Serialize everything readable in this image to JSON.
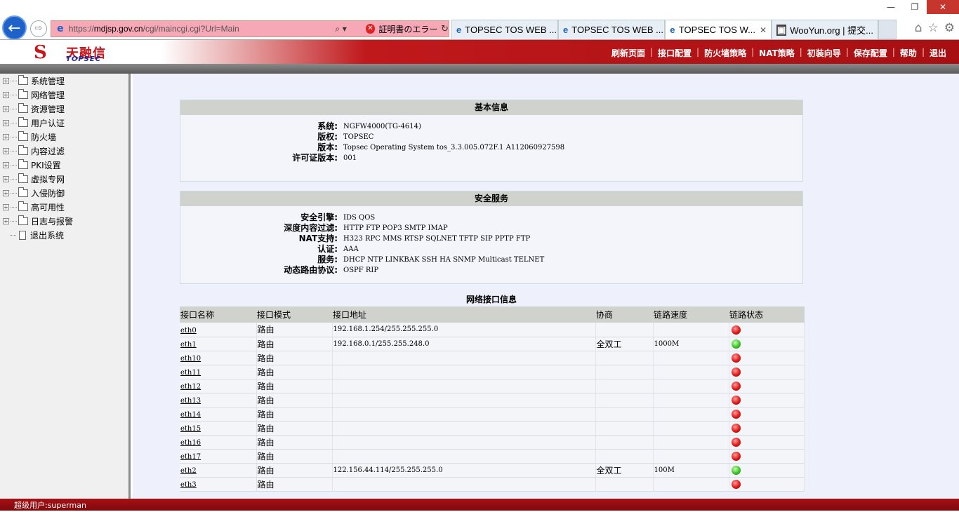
{
  "browser": {
    "address_url_prefix": "https://",
    "address_url_host": "mdjsp.gov.cn",
    "address_url_path": "/cgi/maincgi.cgi?Url=Main",
    "cert_error": "証明書のエラー",
    "tabs": [
      {
        "label": "TOPSEC TOS WEB ...",
        "active": false
      },
      {
        "label": "TOPSEC TOS WEB ...",
        "active": false
      },
      {
        "label": "TOPSEC TOS W...",
        "active": true
      },
      {
        "label": "WooYun.org | 提交...",
        "active": false
      }
    ]
  },
  "header": {
    "logo_cn": "天融信",
    "logo_en": "TOPSEC",
    "menu": [
      "刷新页面",
      "接口配置",
      "防火墙策略",
      "NAT策略",
      "初装向导",
      "保存配置",
      "帮助",
      "退出"
    ]
  },
  "sidebar": {
    "items": [
      "系统管理",
      "网络管理",
      "资源管理",
      "用户认证",
      "防火墙",
      "内容过滤",
      "PKI设置",
      "虚拟专网",
      "入侵防御",
      "高可用性",
      "日志与报警",
      "退出系统"
    ]
  },
  "basic_info": {
    "title": "基本信息",
    "rows": [
      {
        "k": "系统:",
        "v": "NGFW4000(TG-4614)"
      },
      {
        "k": "版权:",
        "v": "TOPSEC"
      },
      {
        "k": "版本:",
        "v": "Topsec Operating System tos_3.3.005.072F.1 A112060927598"
      },
      {
        "k": "许可证版本:",
        "v": "001"
      }
    ]
  },
  "security_services": {
    "title": "安全服务",
    "rows": [
      {
        "k": "安全引擎:",
        "v": "IDS QOS"
      },
      {
        "k": "深度内容过滤:",
        "v": "HTTP FTP POP3 SMTP IMAP"
      },
      {
        "k": "NAT支持:",
        "v": "H323 RPC MMS RTSP SQLNET TFTP SIP PPTP FTP"
      },
      {
        "k": "认证:",
        "v": "AAA"
      },
      {
        "k": "服务:",
        "v": "DHCP NTP LINKBAK SSH HA SNMP Multicast TELNET"
      },
      {
        "k": "动态路由协议:",
        "v": "OSPF RIP"
      }
    ]
  },
  "interfaces": {
    "title": "网络接口信息",
    "columns": [
      "接口名称",
      "接口模式",
      "接口地址",
      "协商",
      "链路速度",
      "链路状态"
    ],
    "rows": [
      {
        "name": "eth0",
        "mode": "路由",
        "addr": "192.168.1.254/255.255.255.0",
        "neg": "",
        "speed": "",
        "status": "down"
      },
      {
        "name": "eth1",
        "mode": "路由",
        "addr": "192.168.0.1/255.255.248.0",
        "neg": "全双工",
        "speed": "1000M",
        "status": "up"
      },
      {
        "name": "eth10",
        "mode": "路由",
        "addr": "",
        "neg": "",
        "speed": "",
        "status": "down"
      },
      {
        "name": "eth11",
        "mode": "路由",
        "addr": "",
        "neg": "",
        "speed": "",
        "status": "down"
      },
      {
        "name": "eth12",
        "mode": "路由",
        "addr": "",
        "neg": "",
        "speed": "",
        "status": "down"
      },
      {
        "name": "eth13",
        "mode": "路由",
        "addr": "",
        "neg": "",
        "speed": "",
        "status": "down"
      },
      {
        "name": "eth14",
        "mode": "路由",
        "addr": "",
        "neg": "",
        "speed": "",
        "status": "down"
      },
      {
        "name": "eth15",
        "mode": "路由",
        "addr": "",
        "neg": "",
        "speed": "",
        "status": "down"
      },
      {
        "name": "eth16",
        "mode": "路由",
        "addr": "",
        "neg": "",
        "speed": "",
        "status": "down"
      },
      {
        "name": "eth17",
        "mode": "路由",
        "addr": "",
        "neg": "",
        "speed": "",
        "status": "down"
      },
      {
        "name": "eth2",
        "mode": "路由",
        "addr": "122.156.44.114/255.255.255.0",
        "neg": "全双工",
        "speed": "100M",
        "status": "up"
      },
      {
        "name": "eth3",
        "mode": "路由",
        "addr": "",
        "neg": "",
        "speed": "",
        "status": "down"
      }
    ]
  },
  "statusbar": {
    "text": "超级用户:superman"
  },
  "colors": {
    "brand_red": "#a70f12",
    "link_up": "#3cc422",
    "link_down": "#e01818"
  }
}
